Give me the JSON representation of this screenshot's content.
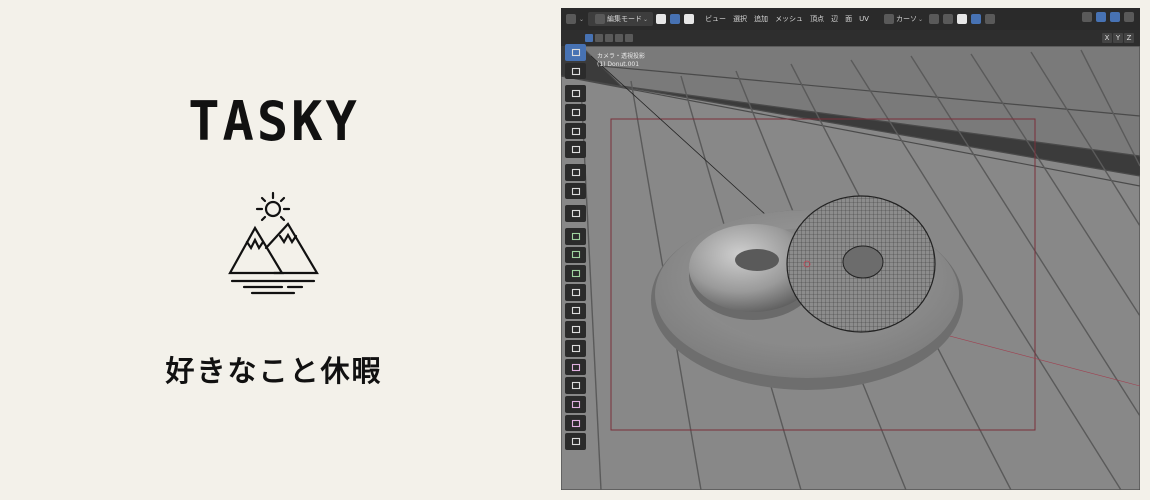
{
  "brand": {
    "title": "TASKY",
    "tagline": "好きなこと休暇",
    "logo_icon": "sun-mountains-icon"
  },
  "blender": {
    "header": {
      "mode": "編集モード",
      "menus": [
        "ビュー",
        "選択",
        "追加",
        "メッシュ",
        "頂点",
        "辺",
        "面",
        "UV"
      ],
      "transform_orientation": "カーソ"
    },
    "axes": [
      "X",
      "Y",
      "Z"
    ],
    "viewport": {
      "camera_label": "カメラ・透視投影",
      "object_label": "(1) Donut.001"
    },
    "toolbar": [
      {
        "name": "select-tool",
        "icon": "cursor-icon",
        "active": true
      },
      {
        "name": "cursor-tool",
        "icon": "crosshair-icon",
        "active": false
      },
      {
        "name": "move-tool",
        "icon": "move-arrows-icon",
        "active": false
      },
      {
        "name": "rotate-tool",
        "icon": "rotate-icon",
        "active": false
      },
      {
        "name": "scale-tool",
        "icon": "scale-icon",
        "active": false
      },
      {
        "name": "transform-tool",
        "icon": "transform-icon",
        "active": false
      },
      {
        "name": "annotate-tool",
        "icon": "pencil-icon",
        "active": false
      },
      {
        "name": "measure-tool",
        "icon": "ruler-icon",
        "active": false
      },
      {
        "name": "add-cube-tool",
        "icon": "add-cube-icon",
        "active": false
      },
      {
        "name": "extrude-tool",
        "icon": "extrude-icon",
        "active": false
      },
      {
        "name": "inset-tool",
        "icon": "inset-icon",
        "active": false
      },
      {
        "name": "bevel-tool",
        "icon": "bevel-icon",
        "active": false
      },
      {
        "name": "loop-cut-tool",
        "icon": "loop-cut-icon",
        "active": false
      },
      {
        "name": "knife-tool",
        "icon": "knife-icon",
        "active": false
      },
      {
        "name": "poly-build-tool",
        "icon": "poly-build-icon",
        "active": false
      },
      {
        "name": "spin-tool",
        "icon": "spin-icon",
        "active": false
      },
      {
        "name": "smooth-tool",
        "icon": "smooth-icon",
        "active": false
      },
      {
        "name": "edge-slide-tool",
        "icon": "edge-slide-icon",
        "active": false
      },
      {
        "name": "shrink-fatten-tool",
        "icon": "shrink-fatten-icon",
        "active": false
      },
      {
        "name": "shear-tool",
        "icon": "shear-icon",
        "active": false
      },
      {
        "name": "rip-tool",
        "icon": "rip-icon",
        "active": false
      }
    ],
    "colors": {
      "header_bg": "#2a2a2a",
      "accent_blue": "#4772b3",
      "camera_frame": "#8a3a40"
    }
  }
}
